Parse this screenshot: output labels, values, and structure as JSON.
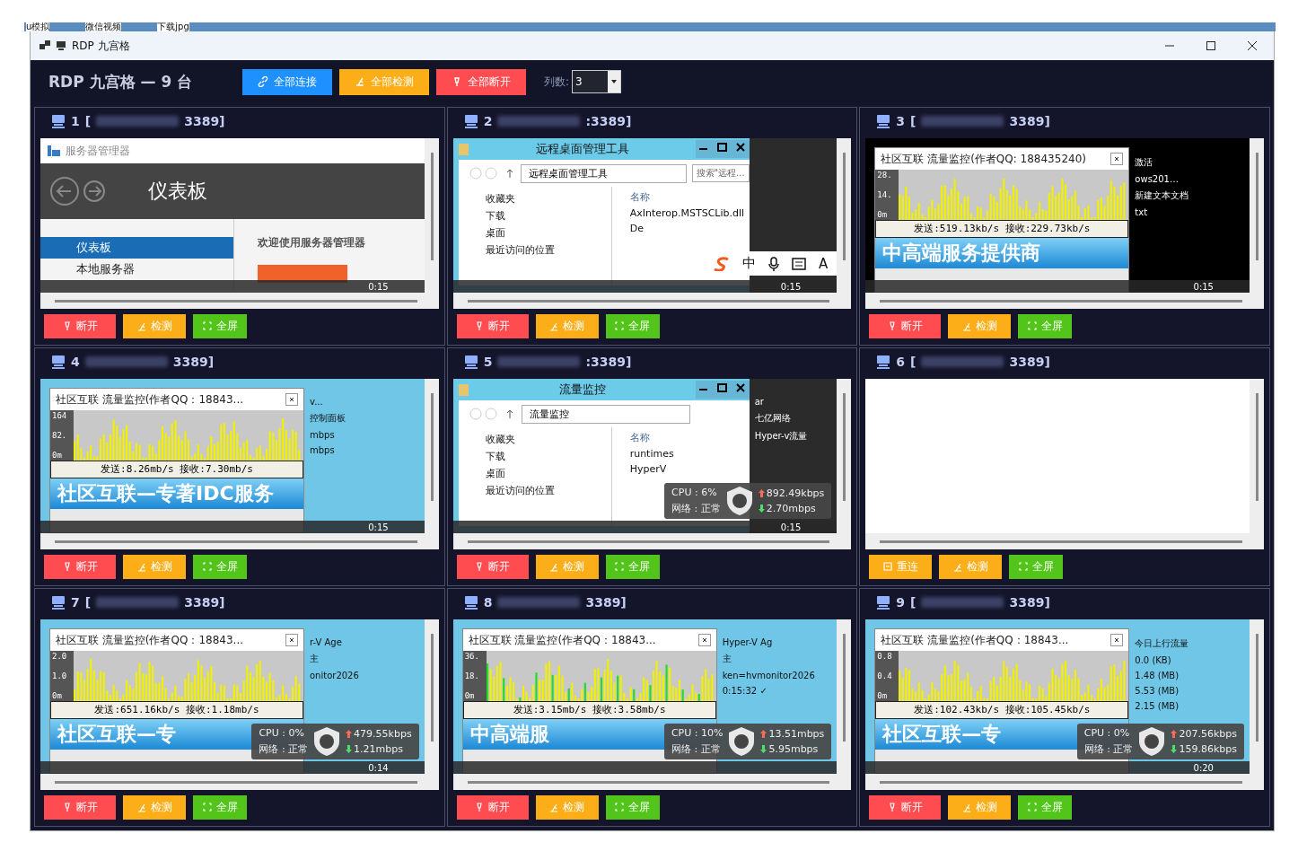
{
  "desktop_strip": [
    "u模拟",
    "微信视频",
    "下载jpg"
  ],
  "window": {
    "title": "RDP 九宫格"
  },
  "header": {
    "title": "RDP 九宫格 — 9 台",
    "buttons": [
      {
        "label": "全部连接",
        "kind": "connect"
      },
      {
        "label": "全部检测",
        "kind": "check"
      },
      {
        "label": "全部断开",
        "kind": "disconnect"
      }
    ],
    "columns": {
      "label": "列数:",
      "value": "3"
    }
  },
  "panes": [
    {
      "number": "1",
      "prefix": "[",
      "tail": "3389]",
      "screen": {
        "kind": "server_manager",
        "app_title": "服务器管理器",
        "page_title": "仪表板",
        "nav": [
          {
            "label": "仪表板",
            "selected": true
          },
          {
            "label": "本地服务器",
            "selected": false
          }
        ],
        "welcome": "欢迎使用服务器管理器",
        "clock": "0:15"
      },
      "buttons": [
        {
          "label": "断开",
          "kind": "disconnect"
        },
        {
          "label": "检测",
          "kind": "check"
        },
        {
          "label": "全屏",
          "kind": "fullscreen"
        }
      ]
    },
    {
      "number": "2",
      "tail": ":3389]",
      "screen": {
        "kind": "explorer",
        "title": "远程桌面管理工具",
        "path": "远程桌面管理工具",
        "search": "搜索\"远程...",
        "nav": [
          "收藏夹",
          "下载",
          "桌面",
          "最近访问的位置"
        ],
        "column": "名称",
        "files": [
          "AxInterop.MSTSCLib.dll",
          "De"
        ],
        "ime": [
          "中",
          "A"
        ],
        "clock": "0:15"
      },
      "buttons": [
        {
          "label": "断开",
          "kind": "disconnect"
        },
        {
          "label": "检测",
          "kind": "check"
        },
        {
          "label": "全屏",
          "kind": "fullscreen"
        }
      ]
    },
    {
      "number": "3",
      "prefix": "[",
      "tail": "3389]",
      "screen": {
        "kind": "monitor",
        "dark_desktop": true,
        "title": "社区互联 流量监控(作者QQ: 188435240)",
        "ticks": [
          "28.",
          "14.",
          "0m"
        ],
        "traffic": "发送:519.13kb/s 接收:229.73kb/s",
        "banner": "中高端服务提供商",
        "side_texts": [
          "激活",
          "ows201…",
          "新建文本文档",
          "txt"
        ],
        "clock": "0:15"
      },
      "buttons": [
        {
          "label": "断开",
          "kind": "disconnect"
        },
        {
          "label": "检测",
          "kind": "check"
        },
        {
          "label": "全屏",
          "kind": "fullscreen"
        }
      ]
    },
    {
      "number": "4",
      "tail": "3389]",
      "screen": {
        "kind": "monitor",
        "dark_desktop": false,
        "title": "社区互联 流量监控(作者QQ：18843...",
        "ticks": [
          "164",
          "82.",
          "0m"
        ],
        "traffic": "发送:8.26mb/s  接收:7.30mb/s",
        "banner": "社区互联—专著IDC服务",
        "side_texts": [
          "v...",
          "控制面板",
          "mbps",
          "mbps"
        ],
        "clock": "0:15"
      },
      "buttons": [
        {
          "label": "断开",
          "kind": "disconnect"
        },
        {
          "label": "检测",
          "kind": "check"
        },
        {
          "label": "全屏",
          "kind": "fullscreen"
        }
      ]
    },
    {
      "number": "5",
      "tail": ":3389]",
      "screen": {
        "kind": "explorer",
        "title": "流量监控",
        "path": "流量监控",
        "nav": [
          "收藏夹",
          "下载",
          "桌面",
          "最近访问的位置"
        ],
        "column": "名称",
        "files": [
          "runtimes",
          "HyperV"
        ],
        "side_texts": [
          "ar",
          "七亿网络",
          "Hyper-v流量"
        ],
        "widget": {
          "cpu": "CPU : 6%",
          "net": "网络 : 正常",
          "up": "892.49kbps",
          "down": "2.70mbps"
        },
        "clock": "0:15"
      },
      "buttons": [
        {
          "label": "断开",
          "kind": "disconnect"
        },
        {
          "label": "检测",
          "kind": "check"
        },
        {
          "label": "全屏",
          "kind": "fullscreen"
        }
      ]
    },
    {
      "number": "6",
      "prefix": "[",
      "tail": "3389]",
      "screen": {
        "kind": "blank"
      },
      "buttons": [
        {
          "label": "重连",
          "kind": "reconnect"
        },
        {
          "label": "检测",
          "kind": "check"
        },
        {
          "label": "全屏",
          "kind": "fullscreen"
        }
      ]
    },
    {
      "number": "7",
      "prefix": "[",
      "tail": "3389]",
      "screen": {
        "kind": "monitor",
        "dark_desktop": false,
        "title": "社区互联 流量监控(作者QQ：18843...",
        "ticks": [
          "2.0",
          "1.0",
          "0m"
        ],
        "traffic": "发送:651.16kb/s 接收:1.18mb/s",
        "banner": "社区互联—专",
        "side_texts": [
          "r-V Age",
          "主",
          "onitor2026"
        ],
        "widget": {
          "cpu": "CPU : 0%",
          "net": "网络 : 正常",
          "up": "479.55kbps",
          "down": "1.21mbps"
        },
        "clock": "0:14"
      },
      "buttons": [
        {
          "label": "断开",
          "kind": "disconnect"
        },
        {
          "label": "检测",
          "kind": "check"
        },
        {
          "label": "全屏",
          "kind": "fullscreen"
        }
      ]
    },
    {
      "number": "8",
      "tail": "3389]",
      "screen": {
        "kind": "monitor",
        "dark_desktop": false,
        "title": "社区互联 流量监控(作者QQ：18843...",
        "ticks": [
          "36.",
          "18.",
          "0m"
        ],
        "traffic": "发送:3.15mb/s   接收:3.58mb/s",
        "banner": "中高端服",
        "side_texts": [
          "Hyper-V Ag",
          "主",
          "ken=hvmonitor2026",
          "0:15:32 ✓"
        ],
        "widget": {
          "cpu": "CPU : 10%",
          "net": "网络 : 正常",
          "up": "13.51mbps",
          "down": "5.95mbps"
        }
      },
      "buttons": [
        {
          "label": "断开",
          "kind": "disconnect"
        },
        {
          "label": "检测",
          "kind": "check"
        },
        {
          "label": "全屏",
          "kind": "fullscreen"
        }
      ]
    },
    {
      "number": "9",
      "prefix": "[",
      "tail": "3389]",
      "screen": {
        "kind": "monitor",
        "dark_desktop": false,
        "title": "社区互联 流量监控(作者QQ：18843...",
        "ticks": [
          "0.8",
          "0.4",
          "0m"
        ],
        "traffic": "发送:102.43kb/s 接收:105.45kb/s",
        "banner": "社区互联—专",
        "side_texts": [
          "今日上行流量",
          "0.0 (KB)",
          "1.48 (MB)",
          "5.53 (MB)",
          "2.15 (MB)"
        ],
        "widget": {
          "cpu": "CPU : 0%",
          "net": "网络 : 正常",
          "up": "207.56kbps",
          "down": "159.86kbps"
        },
        "clock": "0:20"
      },
      "buttons": [
        {
          "label": "断开",
          "kind": "disconnect"
        },
        {
          "label": "检测",
          "kind": "check"
        },
        {
          "label": "全屏",
          "kind": "fullscreen"
        }
      ]
    }
  ]
}
